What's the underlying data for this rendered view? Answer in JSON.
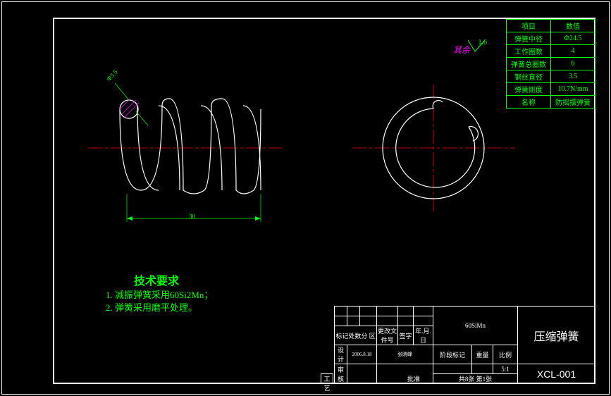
{
  "spec_table": {
    "header": [
      "项目",
      "数值"
    ],
    "rows": [
      [
        "弹簧中径",
        "Φ24.5"
      ],
      [
        "工作圈数",
        "4"
      ],
      [
        "弹簧总圈数",
        "6"
      ],
      [
        "钢丝直径",
        "3.5"
      ],
      [
        "弹簧刚度",
        "10.7N/mm"
      ],
      [
        "名称",
        "防摇摆弹簧"
      ]
    ]
  },
  "annotation": {
    "rest": "其余",
    "rough": "1.6"
  },
  "dimensions": {
    "dia": "Φ3.5",
    "length": "30"
  },
  "tech": {
    "title": "技术要求",
    "l1": "1. 减振弹簧采用60Si2Mn；",
    "l2": "2. 弹簧采用磨平处理。"
  },
  "title_block": {
    "material": "60SiMn",
    "part_name": "压缩弹簧",
    "part_no": "XCL-001",
    "scale_label": "比例",
    "scale": "5:1",
    "mass_label": "重量",
    "stage_label": "阶段标记",
    "sheet": "共8张    第1张",
    "mark_hdr": "标记处数分 区",
    "file_hdr": "更改文件号",
    "sign_hdr": "签字",
    "date_hdr": "年.月.日",
    "design": "设计",
    "design_date": "2006.8.18",
    "design_sign": "张晓峰",
    "review": "审核",
    "process": "工艺",
    "approve": "批准"
  }
}
